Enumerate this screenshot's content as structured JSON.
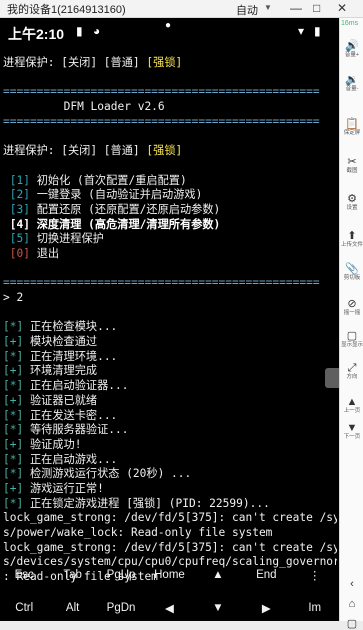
{
  "window": {
    "title": "我的设备1(2164913160)",
    "mode": "自动",
    "minimize_label": "—",
    "restore_label": "□",
    "close_label": "✕"
  },
  "status": {
    "time": "上午2:10",
    "icons": [
      "sim-card-icon",
      "pie-status-icon",
      "notch-dot-icon",
      "wifi-icon",
      "battery-icon"
    ]
  },
  "terminal": {
    "lines": [
      [
        {
          "t": "进程保护: [关闭] [普通] ",
          "c": "c-w"
        },
        {
          "t": "[强锁]",
          "c": "c-y"
        }
      ],
      [
        {
          "t": "",
          "c": "c-w"
        }
      ],
      [
        {
          "t": "===============================================",
          "c": "c-cy"
        }
      ],
      [
        {
          "t": "         DFM Loader v2.6",
          "c": "c-w"
        }
      ],
      [
        {
          "t": "===============================================",
          "c": "c-cy"
        }
      ],
      [
        {
          "t": "",
          "c": "c-w"
        }
      ],
      [
        {
          "t": "进程保护: [关闭] [普通] ",
          "c": "c-w"
        },
        {
          "t": "[强锁]",
          "c": "c-y"
        }
      ],
      [
        {
          "t": "",
          "c": "c-w"
        }
      ],
      [
        {
          "t": " [1]",
          "c": "c-bl"
        },
        {
          "t": " 初始化 (首次配置/重启配置)",
          "c": "c-w"
        }
      ],
      [
        {
          "t": " [2]",
          "c": "c-bl"
        },
        {
          "t": " 一键登录 (自动验证并启动游戏)",
          "c": "c-w"
        }
      ],
      [
        {
          "t": " [3]",
          "c": "c-bl"
        },
        {
          "t": " 配置还原 (还原配置/还原启动参数)",
          "c": "c-w"
        }
      ],
      [
        {
          "t": " [4]",
          "c": "c-bw"
        },
        {
          "t": " 深度清理 (高危清理/清理所有参数)",
          "c": "c-bw"
        }
      ],
      [
        {
          "t": " [5]",
          "c": "c-bl"
        },
        {
          "t": " 切换进程保护",
          "c": "c-w"
        }
      ],
      [
        {
          "t": " [0]",
          "c": "c-r"
        },
        {
          "t": " 退出",
          "c": "c-w"
        }
      ],
      [
        {
          "t": "",
          "c": "c-w"
        }
      ],
      [
        {
          "t": "===============================================",
          "c": "c-cy"
        }
      ],
      [
        {
          "t": "> 2",
          "c": "c-w"
        }
      ],
      [
        {
          "t": "",
          "c": "c-w"
        }
      ],
      [
        {
          "t": "[*]",
          "c": "c-gr"
        },
        {
          "t": " 正在检查模块...",
          "c": "c-w"
        }
      ],
      [
        {
          "t": "[+]",
          "c": "c-gr"
        },
        {
          "t": " 模块检查通过",
          "c": "c-w"
        }
      ],
      [
        {
          "t": "[*]",
          "c": "c-gr"
        },
        {
          "t": " 正在清理环境...",
          "c": "c-w"
        }
      ],
      [
        {
          "t": "[+]",
          "c": "c-gr"
        },
        {
          "t": " 环境清理完成",
          "c": "c-w"
        }
      ],
      [
        {
          "t": "[*]",
          "c": "c-gr"
        },
        {
          "t": " 正在启动验证器...",
          "c": "c-w"
        }
      ],
      [
        {
          "t": "[+]",
          "c": "c-gr"
        },
        {
          "t": " 验证器已就绪",
          "c": "c-w"
        }
      ],
      [
        {
          "t": "[*]",
          "c": "c-gr"
        },
        {
          "t": " 正在发送卡密...",
          "c": "c-w"
        }
      ],
      [
        {
          "t": "[*]",
          "c": "c-gr"
        },
        {
          "t": " 等待服务器验证...",
          "c": "c-w"
        }
      ],
      [
        {
          "t": "[+]",
          "c": "c-gr"
        },
        {
          "t": " 验证成功!",
          "c": "c-w"
        }
      ],
      [
        {
          "t": "[*]",
          "c": "c-gr"
        },
        {
          "t": " 正在启动游戏...",
          "c": "c-w"
        }
      ],
      [
        {
          "t": "[*]",
          "c": "c-gr"
        },
        {
          "t": " 检测游戏运行状态 (20秒) ...",
          "c": "c-w"
        }
      ],
      [
        {
          "t": "[+]",
          "c": "c-gr"
        },
        {
          "t": " 游戏运行正常!",
          "c": "c-w"
        }
      ],
      [
        {
          "t": "[*]",
          "c": "c-gr"
        },
        {
          "t": " 正在锁定游戏进程 [强锁] (PID: 22599)...",
          "c": "c-w"
        }
      ],
      [
        {
          "t": "lock_game_strong: /dev/fd/5[375]: can't create /sy",
          "c": "c-w"
        }
      ],
      [
        {
          "t": "s/power/wake_lock: Read-only file system",
          "c": "c-w"
        }
      ],
      [
        {
          "t": "lock_game_strong: /dev/fd/5[375]: can't create /sy",
          "c": "c-w"
        }
      ],
      [
        {
          "t": "s/devices/system/cpu/cpu0/cpufreq/scaling_governor",
          "c": "c-w"
        }
      ],
      [
        {
          "t": ": Read-only file system",
          "c": "c-w"
        }
      ]
    ]
  },
  "extra_keys": {
    "row1": [
      "Esc",
      "Tab",
      "PgUp",
      "Home",
      "▲",
      "End",
      "⋮"
    ],
    "row2": [
      "Ctrl",
      "Alt",
      "PgDn",
      "◀",
      "▼",
      "▶",
      "Im"
    ]
  },
  "sidebar": {
    "fps": "16ms",
    "items": [
      {
        "icon": "🔊",
        "label": "音量+",
        "name": "volume-up-icon"
      },
      {
        "icon": "🔉",
        "label": "音量-",
        "name": "volume-down-icon"
      },
      {
        "icon": "📋",
        "label": "保定屏",
        "name": "clipboard-icon"
      },
      {
        "icon": "✂",
        "label": "截图",
        "name": "screenshot-icon"
      },
      {
        "icon": "⚙",
        "label": "设置",
        "name": "gear-icon"
      },
      {
        "icon": "⬆",
        "label": "上传文件",
        "name": "upload-icon"
      },
      {
        "icon": "📎",
        "label": "剪切板",
        "name": "paperclip-icon"
      },
      {
        "icon": "⊘",
        "label": "摇一摇",
        "name": "shake-icon"
      },
      {
        "icon": "▢",
        "label": "显示显示",
        "name": "display-icon"
      },
      {
        "icon": "⤢",
        "label": "方向",
        "name": "rotate-icon"
      },
      {
        "icon": "▲",
        "label": "上一页",
        "name": "page-up-icon"
      },
      {
        "icon": "▼",
        "label": "下一页",
        "name": "page-down-icon"
      },
      {
        "icon": "‹",
        "label": "",
        "name": "back-icon"
      },
      {
        "icon": "⌂",
        "label": "",
        "name": "home-icon"
      },
      {
        "icon": "▢",
        "label": "",
        "name": "recents-icon"
      }
    ]
  }
}
